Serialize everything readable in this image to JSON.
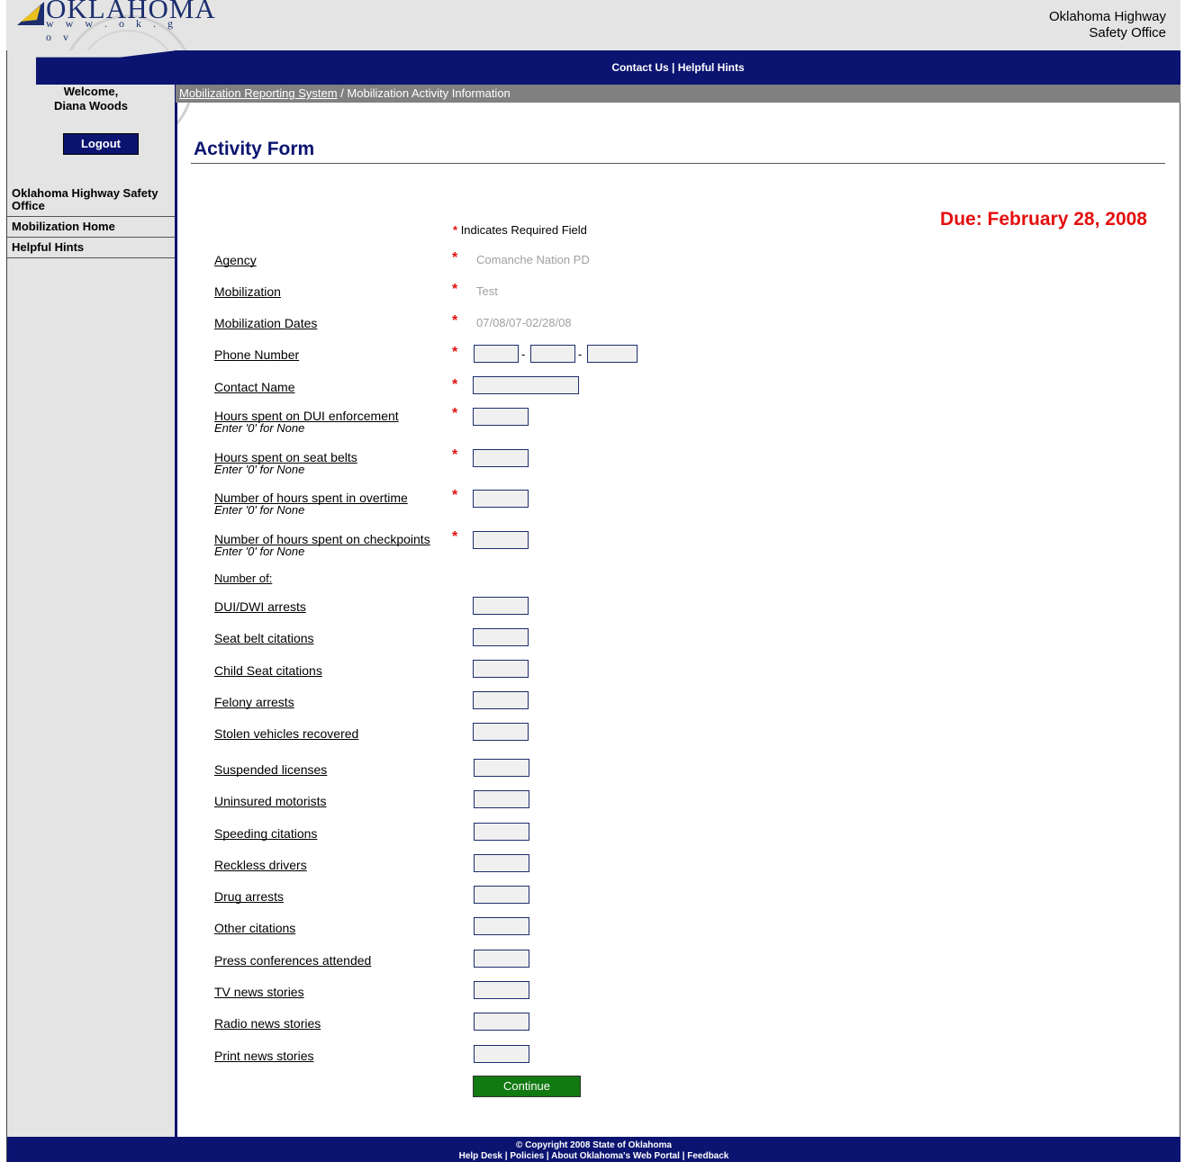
{
  "header": {
    "logo_word": "OKLAHOMA",
    "logo_url": "w w w . o k . g o v",
    "agency_line1": "Oklahoma Highway",
    "agency_line2": "Safety Office"
  },
  "topnav": {
    "contact": "Contact Us",
    "separator": " | ",
    "hints": "Helpful Hints"
  },
  "breadcrumb": {
    "root": "Mobilization Reporting System",
    "separator": " / ",
    "current": "Mobilization Activity Information"
  },
  "sidebar": {
    "welcome": "Welcome,",
    "user": "Diana Woods",
    "logout": "Logout",
    "items": [
      {
        "label": "Oklahoma Highway Safety Office"
      },
      {
        "label": "Mobilization Home"
      },
      {
        "label": "Helpful Hints"
      }
    ]
  },
  "form": {
    "title": "Activity Form",
    "due": "Due: February 28, 2008",
    "required_note": "Indicates Required Field",
    "hint_zero": "Enter '0' for None",
    "agency_label": "Agency",
    "agency_value": "Comanche Nation PD",
    "mobilization_label": "Mobilization",
    "mobilization_value": "Test",
    "dates_label": "Mobilization Dates",
    "dates_value": "07/08/07-02/28/08",
    "phone_label": "Phone Number",
    "contact_label": "Contact Name",
    "dui_hours_label": "Hours spent on DUI enforcement",
    "seatbelt_hours_label": "Hours spent on seat belts",
    "overtime_label": "Number of hours spent in overtime",
    "checkpoint_label": "Number of hours spent on checkpoints",
    "number_of": "Number of:",
    "counts": [
      "DUI/DWI arrests",
      "Seat belt citations",
      "Child Seat citations",
      "Felony arrests",
      "Stolen vehicles recovered",
      "Suspended licenses",
      "Uninsured motorists",
      "Speeding citations",
      "Reckless drivers",
      "Drug arrests",
      "Other citations",
      "Press conferences attended",
      "TV news stories",
      "Radio news stories",
      "Print news stories"
    ],
    "continue": "Continue"
  },
  "footer": {
    "copyright": "© Copyright 2008 State of Oklahoma",
    "links": "Help Desk | Policies | About Oklahoma's Web Portal | Feedback"
  },
  "colors": {
    "navy": "#0b1470",
    "required_red": "#e41010",
    "continue_green": "#117a11"
  }
}
